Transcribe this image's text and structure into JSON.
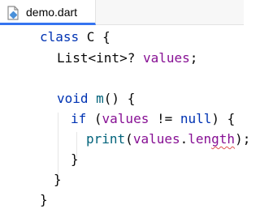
{
  "tab": {
    "filename": "demo.dart",
    "icon": "dart-file-icon"
  },
  "colors": {
    "keyword": "#0033b3",
    "field": "#871094",
    "function": "#00627a",
    "text": "#080808",
    "active_tab_underline": "#3574f0",
    "spellcheck_underline": "#e05252"
  },
  "code": {
    "line1": {
      "kw": "class",
      "rest": " C {"
    },
    "line2": {
      "type": "List<int>? ",
      "field": "values",
      "end": ";"
    },
    "line4": {
      "kw": "void",
      "name": " m",
      "rest": "() {"
    },
    "line5": {
      "kw": "if",
      "open": " (",
      "field": "values",
      "op": " != ",
      "null": "null",
      "close": ") {"
    },
    "line6": {
      "fn": "print",
      "open": "(",
      "field": "values",
      "dot": ".",
      "prop_plain": "len",
      "prop_typo": "gth",
      "close": ");"
    },
    "line7": {
      "text": "}"
    },
    "line8": {
      "text": "}"
    },
    "line9": {
      "text": "}"
    }
  }
}
